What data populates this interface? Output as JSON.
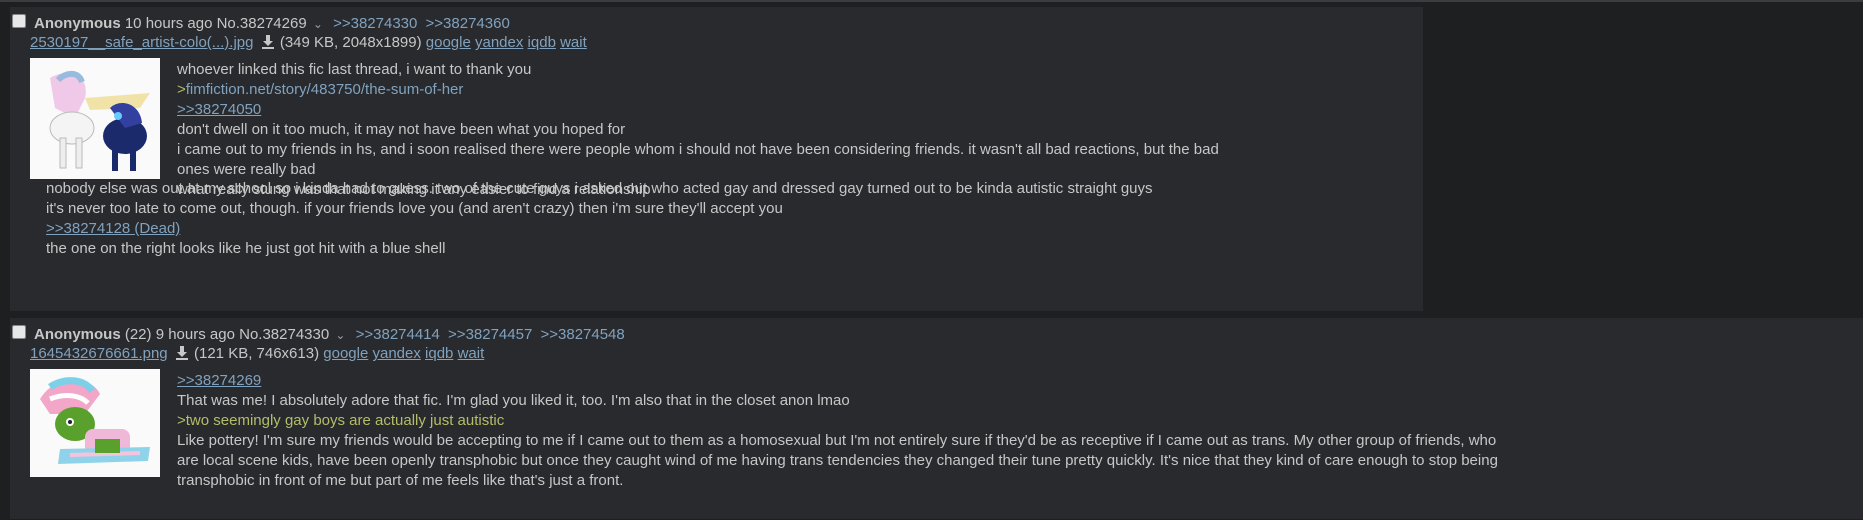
{
  "posts": [
    {
      "name": "Anonymous",
      "time": "10 hours ago",
      "number": "No.38274269",
      "replies": [
        ">>38274330",
        ">>38274360"
      ],
      "file": {
        "filename": "2530197__safe_artist-colo(...).jpg",
        "meta": "(349 KB, 2048x1899)",
        "search_links": [
          "google",
          "yandex",
          "iqdb",
          "wait"
        ]
      },
      "lines_right": [
        {
          "text": "whoever linked this fic last thread, i want to thank you",
          "kind": "text"
        },
        {
          "text": ">fimfiction.net/story/483750/the-sum-of-her",
          "kind": "quote-link"
        },
        {
          "text": ">>38274050",
          "kind": "postlink"
        },
        {
          "text": "don't dwell on it too much, it may not have been what you hoped for",
          "kind": "text"
        },
        {
          "text": "i came out to my friends in hs, and i soon realised there were people whom i should not have been considering friends. it wasn't all bad reactions, but the bad",
          "kind": "text"
        },
        {
          "text": "ones were really bad",
          "kind": "text"
        },
        {
          "text": "what really stung was that not making it any easier to find a relationship",
          "kind": "text"
        }
      ],
      "lines_below": [
        {
          "text": "nobody else was out at my school so i kinda had to guess. two of the cute guys i asked out who acted gay and dressed gay turned out to be kinda autistic straight guys",
          "kind": "text"
        },
        {
          "text": "it's never too late to come out, though. if your friends love you (and aren't crazy) then i'm sure they'll accept you",
          "kind": "text"
        },
        {
          "text": ">>38274128 (Dead)",
          "kind": "dead"
        },
        {
          "text": "the one on the right looks like he just got hit with a blue shell",
          "kind": "text"
        }
      ]
    },
    {
      "name": "Anonymous",
      "poster_count": "(22)",
      "time": "9 hours ago",
      "number": "No.38274330",
      "replies": [
        ">>38274414",
        ">>38274457",
        ">>38274548"
      ],
      "file": {
        "filename": "1645432676661.png",
        "meta": "(121 KB, 746x613)",
        "search_links": [
          "google",
          "yandex",
          "iqdb",
          "wait"
        ]
      },
      "lines_right": [
        {
          "text": ">>38274269",
          "kind": "postlink"
        },
        {
          "text": "That was me! I absolutely adore that fic. I'm glad you liked it, too. I'm also that in the closet anon lmao",
          "kind": "text"
        },
        {
          "text": ">two seemingly gay boys are actually just autistic",
          "kind": "greentext"
        },
        {
          "text": "Like pottery! I'm sure my friends would be accepting to me if I came out to them as a homosexual but I'm not entirely sure if they'd be as receptive if I came out as trans. My other group of friends, who are local scene kids, have been openly transphobic but once they caught wind of me having trans tendencies they changed their tune pretty quickly. It's nice that they kind of care enough to stop being transphobic in front of me but part of me feels like that's just a front.",
          "kind": "wrap"
        }
      ]
    }
  ],
  "colors": {
    "page_bg": "#1d1f21",
    "post_bg": "#282a2e",
    "text": "#c5c8c6",
    "link": "#81a2be",
    "greentext": "#b5bd68"
  },
  "icons": {
    "download": "download-icon",
    "chevron": "chevron-down-icon",
    "checkbox": "select-checkbox"
  }
}
